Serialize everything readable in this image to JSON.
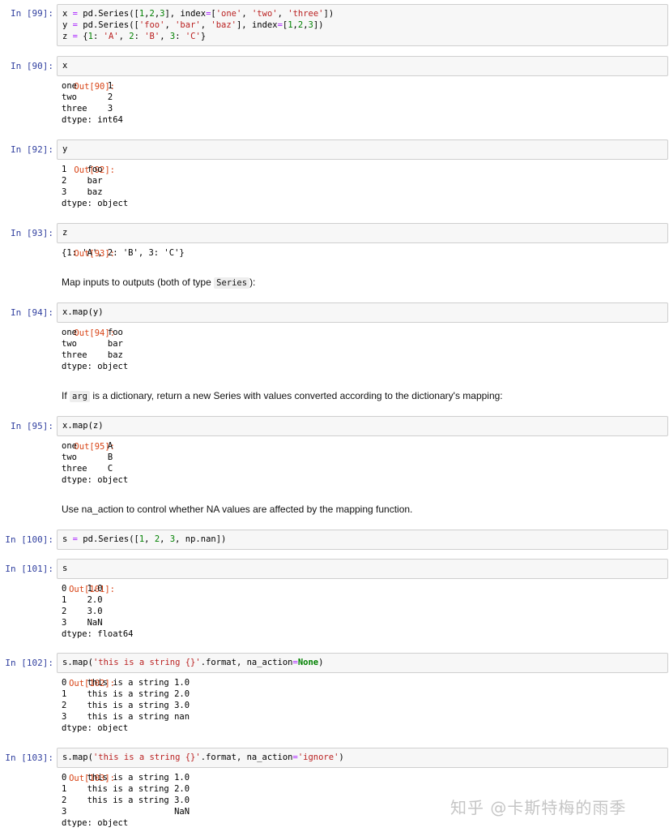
{
  "cells": [
    {
      "in_prompt": "In  [99]:",
      "code_lines": [
        "x = pd.Series([1,2,3], index=['one', 'two', 'three'])",
        "y = pd.Series(['foo', 'bar', 'baz'], index=[1,2,3])",
        "z = {1: 'A', 2: 'B', 3: 'C'}"
      ]
    },
    {
      "in_prompt": "In  [90]:",
      "code": "x",
      "out_prompt": "Out[90]:",
      "output": "one      1\ntwo      2\nthree    3\ndtype: int64"
    },
    {
      "in_prompt": "In  [92]:",
      "code": "y",
      "out_prompt": "Out[92]:",
      "output": "1    foo\n2    bar\n3    baz\ndtype: object"
    },
    {
      "in_prompt": "In  [93]:",
      "code": "z",
      "out_prompt": "Out[93]:",
      "output": "{1: 'A', 2: 'B', 3: 'C'}"
    },
    {
      "in_prompt": "In  [94]:",
      "code": "x.map(y)",
      "out_prompt": "Out[94]:",
      "output": "one      foo\ntwo      bar\nthree    baz\ndtype: object"
    },
    {
      "in_prompt": "In  [95]:",
      "code": "x.map(z)",
      "out_prompt": "Out[95]:",
      "output": "one      A\ntwo      B\nthree    C\ndtype: object"
    },
    {
      "in_prompt": "In  [100]:",
      "code": "s = pd.Series([1, 2, 3, np.nan])"
    },
    {
      "in_prompt": "In  [101]:",
      "code": "s",
      "out_prompt": "Out[101]:",
      "output": "0    1.0\n1    2.0\n2    3.0\n3    NaN\ndtype: float64"
    },
    {
      "in_prompt": "In  [102]:",
      "code": "s.map('this is a string {}'.format, na_action=None)",
      "out_prompt": "Out[102]:",
      "output": "0    this is a string 1.0\n1    this is a string 2.0\n2    this is a string 3.0\n3    this is a string nan\ndtype: object"
    },
    {
      "in_prompt": "In  [103]:",
      "code": "s.map('this is a string {}'.format, na_action='ignore')",
      "out_prompt": "Out[103]:",
      "output": "0    this is a string 1.0\n1    this is a string 2.0\n2    this is a string 3.0\n3                     NaN\ndtype: object"
    }
  ],
  "markdown": {
    "map_inputs_pre": "Map inputs to outputs (both of type ",
    "map_inputs_code": "Series",
    "map_inputs_post": "):",
    "if_arg_pre": "If ",
    "if_arg_code": "arg",
    "if_arg_post": " is a dictionary, return a new Series with values converted according to the dictionary's mapping:",
    "na_action_text": "Use na_action to control whether NA values are affected by the mapping function."
  },
  "watermark": "知乎 @卡斯特梅的雨季"
}
